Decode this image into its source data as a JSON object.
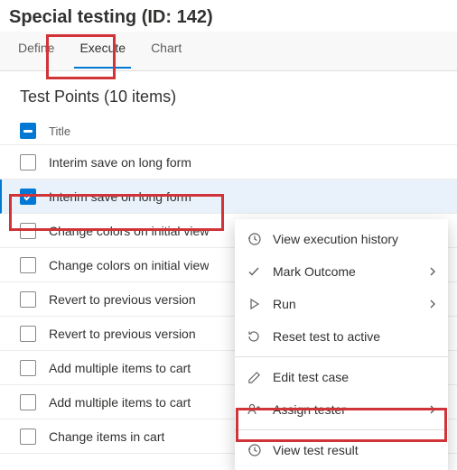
{
  "title": "Special testing (ID: 142)",
  "tabs": {
    "define": "Define",
    "execute": "Execute",
    "chart": "Chart"
  },
  "section": {
    "title": "Test Points (10 items)"
  },
  "header": {
    "title_col": "Title"
  },
  "rows": [
    {
      "title": "Interim save on long form",
      "checked": false,
      "selected": false
    },
    {
      "title": "Interim save on long form",
      "checked": true,
      "selected": true
    },
    {
      "title": "Change colors on initial view",
      "checked": false,
      "selected": false
    },
    {
      "title": "Change colors on initial view",
      "checked": false,
      "selected": false
    },
    {
      "title": "Revert to previous version",
      "checked": false,
      "selected": false
    },
    {
      "title": "Revert to previous version",
      "checked": false,
      "selected": false
    },
    {
      "title": "Add multiple items to cart",
      "checked": false,
      "selected": false
    },
    {
      "title": "Add multiple items to cart",
      "checked": false,
      "selected": false
    },
    {
      "title": "Change items in cart",
      "checked": false,
      "selected": false
    }
  ],
  "menu": {
    "view_history": "View execution history",
    "mark_outcome": "Mark Outcome",
    "run": "Run",
    "reset": "Reset test to active",
    "edit": "Edit test case",
    "assign": "Assign tester",
    "view_result": "View test result"
  }
}
